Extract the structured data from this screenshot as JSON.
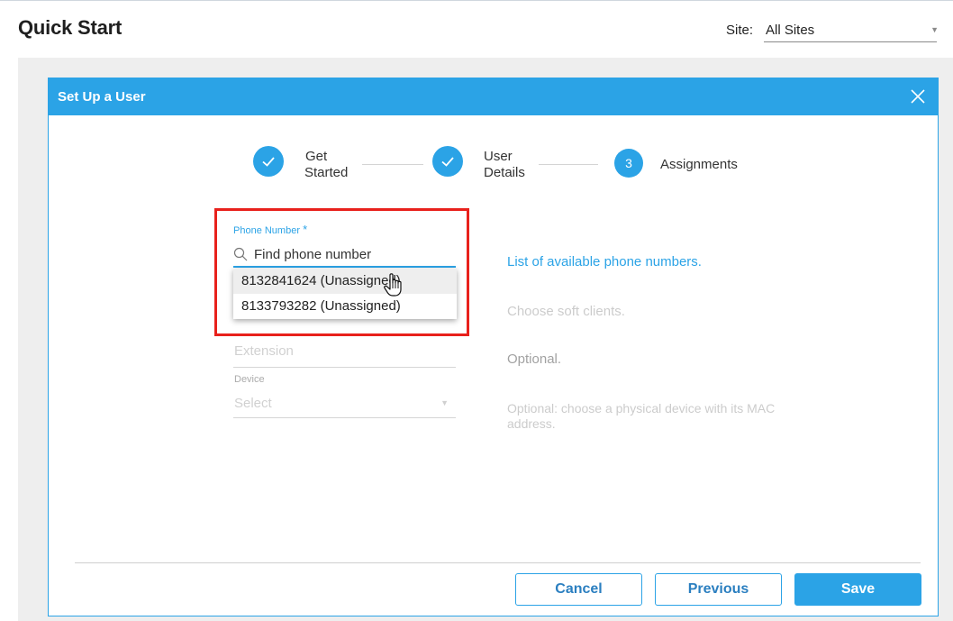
{
  "page": {
    "title": "Quick Start",
    "site_label": "Site:",
    "site_value": "All Sites"
  },
  "modal": {
    "title": "Set Up a User",
    "steps": [
      {
        "line1": "Get",
        "line2": "Started",
        "status": "complete"
      },
      {
        "line1": "User",
        "line2": "Details",
        "status": "complete"
      },
      {
        "number": "3",
        "label": "Assignments",
        "status": "current"
      }
    ],
    "phone": {
      "label": "Phone Number",
      "required_mark": "*",
      "placeholder": "Find phone number",
      "options": [
        "8132841624 (Unassigned)",
        "8133793282 (Unassigned)"
      ],
      "hint": "List of available phone numbers."
    },
    "soft_clients_hint": "Choose soft clients.",
    "extension": {
      "placeholder": "Extension",
      "hint": "Optional."
    },
    "device": {
      "label": "Device",
      "value": "Select",
      "hint_line1": "Optional: choose a physical device with its MAC",
      "hint_line2": "address."
    },
    "buttons": {
      "cancel": "Cancel",
      "previous": "Previous",
      "save": "Save"
    }
  },
  "colors": {
    "accent": "#2ba3e6",
    "highlight": "#e8211c"
  }
}
